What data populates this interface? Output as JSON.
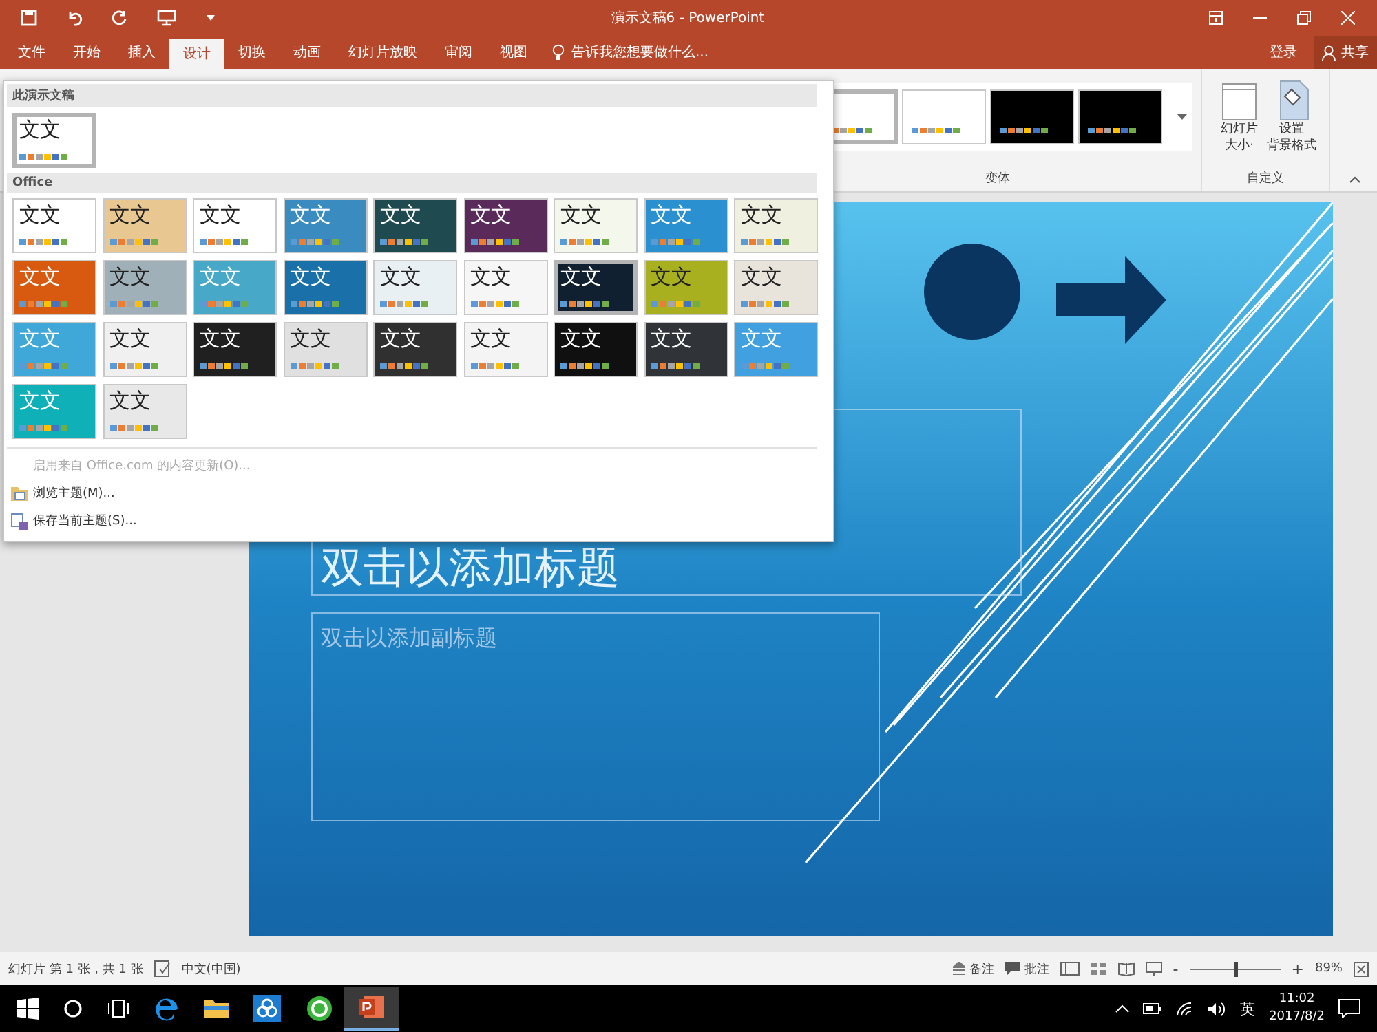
{
  "window": {
    "title": "演示文稿6 - PowerPoint"
  },
  "ribbon_tabs": [
    {
      "label": "文件",
      "selected": false
    },
    {
      "label": "开始",
      "selected": false
    },
    {
      "label": "插入",
      "selected": false
    },
    {
      "label": "设计",
      "selected": true
    },
    {
      "label": "切换",
      "selected": false
    },
    {
      "label": "动画",
      "selected": false
    },
    {
      "label": "幻灯片放映",
      "selected": false
    },
    {
      "label": "审阅",
      "selected": false
    },
    {
      "label": "视图",
      "selected": false
    }
  ],
  "tell_me": {
    "placeholder": "告诉我您想要做什么..."
  },
  "account": {
    "sign_in": "登录",
    "share": "共享"
  },
  "variants": {
    "label": "变体",
    "items": [
      {
        "color": "#ffffff",
        "selected": true
      },
      {
        "color": "#ffffff",
        "selected": false
      },
      {
        "color": "#000000",
        "selected": false
      },
      {
        "color": "#000000",
        "selected": false
      }
    ]
  },
  "customize": {
    "label": "自定义",
    "buttons": [
      {
        "lines": [
          "幻灯片",
          "大小·"
        ],
        "kind": "size"
      },
      {
        "lines": [
          "设置",
          "背景格式"
        ],
        "kind": "background"
      }
    ]
  },
  "theme_gallery": {
    "current_section": "此演示文稿",
    "current": [
      {
        "label": "文文",
        "color": "#ffffff",
        "selected": true
      }
    ],
    "office_section": "Office",
    "office": [
      {
        "label": "文文",
        "color": "#ffffff",
        "selected": false
      },
      {
        "label": "文文",
        "color": "#e8c890",
        "selected": false
      },
      {
        "label": "文文",
        "color": "#ffffff",
        "selected": false
      },
      {
        "label": "文文",
        "color": "#3a8cc0",
        "selected": false
      },
      {
        "label": "文文",
        "color": "#1e4a50",
        "selected": false
      },
      {
        "label": "文文",
        "color": "#5a2a5a",
        "selected": false
      },
      {
        "label": "文文",
        "color": "#f4f8ec",
        "selected": false
      },
      {
        "label": "文文",
        "color": "#2a90d0",
        "selected": false
      },
      {
        "label": "文文",
        "color": "#f0f0e0",
        "selected": false
      },
      {
        "label": "文文",
        "color": "#d85a10",
        "selected": false
      },
      {
        "label": "文文",
        "color": "#a0b0b8",
        "selected": false
      },
      {
        "label": "文文",
        "color": "#48a8c8",
        "selected": false
      },
      {
        "label": "文文",
        "color": "#1a70a8",
        "selected": false
      },
      {
        "label": "文文",
        "color": "#e8f0f4",
        "selected": false
      },
      {
        "label": "文文",
        "color": "#f6f6f6",
        "selected": false
      },
      {
        "label": "文文",
        "color": "#102030",
        "selected": true
      },
      {
        "label": "文文",
        "color": "#a8b020",
        "selected": false
      },
      {
        "label": "文文",
        "color": "#e8e4dc",
        "selected": false
      },
      {
        "label": "文文",
        "color": "#40a8d8",
        "selected": false
      },
      {
        "label": "文文",
        "color": "#f0f0f0",
        "selected": false
      },
      {
        "label": "文文",
        "color": "#202020",
        "selected": false
      },
      {
        "label": "文文",
        "color": "#e0e0e0",
        "selected": false
      },
      {
        "label": "文文",
        "color": "#303030",
        "selected": false
      },
      {
        "label": "文文",
        "color": "#f4f4f4",
        "selected": false
      },
      {
        "label": "文文",
        "color": "#101010",
        "selected": false
      },
      {
        "label": "文文",
        "color": "#303438",
        "selected": false
      },
      {
        "label": "文文",
        "color": "#40a0e0",
        "selected": false
      },
      {
        "label": "文文",
        "color": "#10b0b8",
        "selected": false
      },
      {
        "label": "文文",
        "color": "#e8e8e8",
        "selected": false
      }
    ],
    "menu": [
      {
        "label": "启用来自 Office.com 的内容更新(O)...",
        "disabled": true,
        "kind": "none"
      },
      {
        "label": "浏览主题(M)...",
        "disabled": false,
        "kind": "browse"
      },
      {
        "label": "保存当前主题(S)...",
        "disabled": false,
        "kind": "save"
      }
    ]
  },
  "slide": {
    "title_placeholder": "双击以添加标题",
    "subtitle_placeholder": "双击以添加副标题"
  },
  "status_bar": {
    "slide_info": "幻灯片 第 1 张，共 1 张",
    "language": "中文(中国)",
    "notes": "备注",
    "comments": "批注",
    "zoom": {
      "zoom_out": "-",
      "zoom_in": "+",
      "level": 0.5,
      "reading": "89%"
    }
  },
  "taskbar": {
    "ime": "英",
    "time": "11:02",
    "date": "2017/8/2"
  }
}
